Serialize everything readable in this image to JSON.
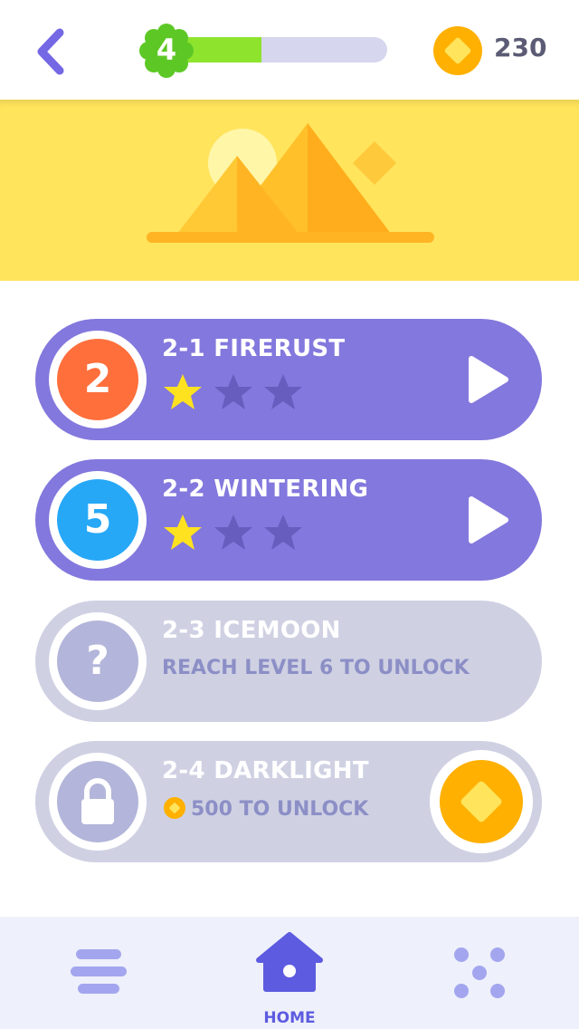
{
  "header": {
    "level": "4",
    "xp_progress": 0.41,
    "coins": "230",
    "back_icon": "chevron-left-icon",
    "coin_icon": "coin-icon"
  },
  "banner": {
    "illustration": "pyramids-illustration"
  },
  "levels": [
    {
      "title": "2-1 FIRERUST",
      "badge": "2",
      "stars_earned": 1,
      "stars_total": 3,
      "state": "playable"
    },
    {
      "title": "2-2 WINTERING",
      "badge": "5",
      "stars_earned": 1,
      "stars_total": 3,
      "state": "playable"
    },
    {
      "title": "2-3 ICEMOON",
      "badge": "?",
      "subtitle": "REACH LEVEL 6 TO UNLOCK",
      "state": "locked"
    },
    {
      "title": "2-4 DARKLIGHT",
      "subtitle": "500 TO UNLOCK",
      "state": "purchasable"
    }
  ],
  "nav": {
    "home_label": "HOME"
  },
  "colors": {
    "accent": "#8378dd",
    "xp_green": "#8ee42d",
    "coin_gold": "#ffb000",
    "banner_yellow": "#ffe45c",
    "locked_gray": "#cfd1e3",
    "badge_orange": "#ff6f3c",
    "badge_blue": "#27a8f7"
  }
}
